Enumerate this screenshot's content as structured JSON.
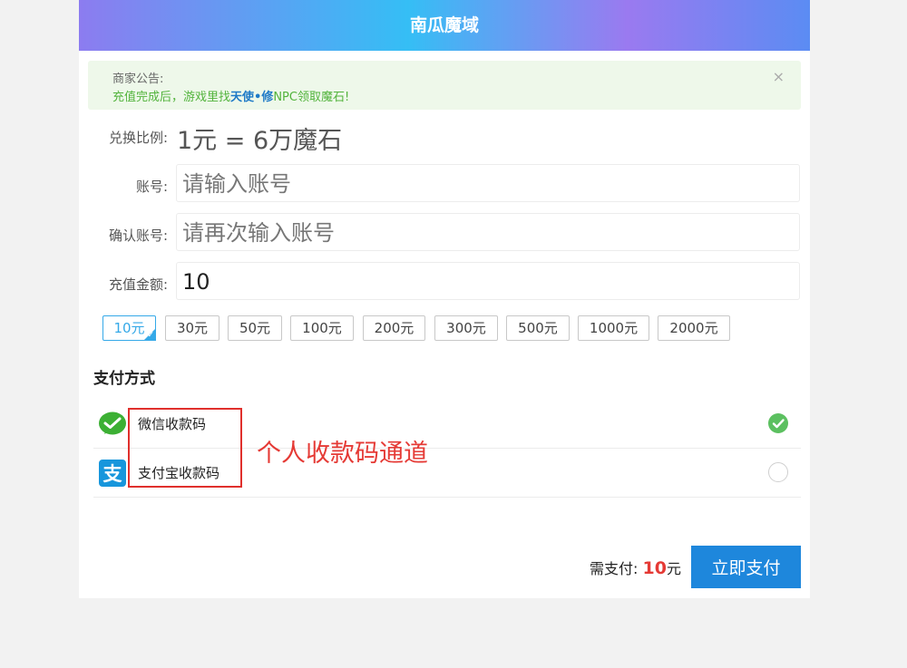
{
  "header": {
    "title": "南瓜魔域"
  },
  "notice": {
    "title": "商家公告:",
    "msg_prefix": "充值完成后，游戏里找",
    "msg_highlight": "天使•修",
    "msg_suffix": "NPC领取魔石!",
    "close_glyph": "×"
  },
  "form": {
    "ratio_label": "兑换比例:",
    "ratio_value": "1元 = 6万魔石",
    "account_label": "账号:",
    "account_placeholder": "请输入账号",
    "confirm_label": "确认账号:",
    "confirm_placeholder": "请再次输入账号",
    "amount_label": "充值金额:",
    "amount_value": "10"
  },
  "amounts": {
    "options": [
      "10元",
      "30元",
      "50元",
      "100元",
      "200元",
      "300元",
      "500元",
      "1000元",
      "2000元"
    ],
    "selected": "10元"
  },
  "payment": {
    "title": "支付方式",
    "methods": [
      {
        "label": "微信收款码",
        "icon": "wechat-icon",
        "selected": true
      },
      {
        "label": "支付宝收款码",
        "icon": "alipay-icon",
        "selected": false
      }
    ]
  },
  "annotation": {
    "note": "个人收款码通道",
    "color": "#e53a35"
  },
  "footer": {
    "total_label": "需支付:",
    "total_amount": "10",
    "total_unit": "元",
    "pay_button": "立即支付"
  },
  "colors": {
    "accent": "#1e87dc",
    "selected_amount": "#35a9e8",
    "check": "#5cc060",
    "notice_bg": "#eef8ea",
    "price": "#e53a35"
  }
}
